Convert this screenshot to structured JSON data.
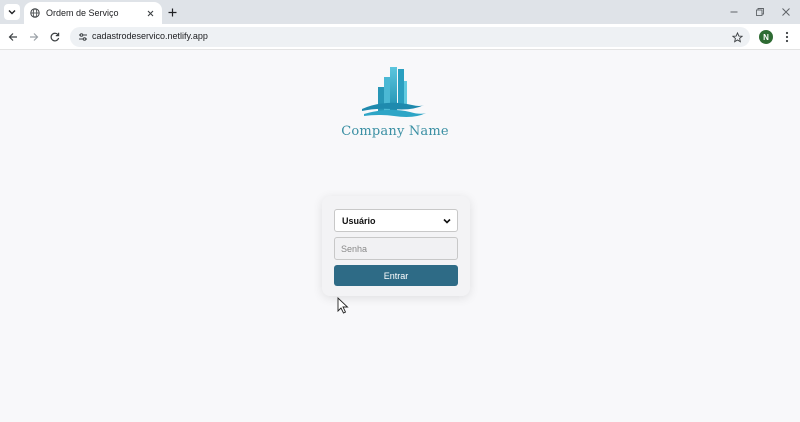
{
  "browser": {
    "tab": {
      "title": "Ordem de Serviço"
    },
    "address_bar": {
      "url": "cadastrodeservico.netlify.app"
    },
    "profile_initial": "N",
    "icons": [
      "tab-search-icon",
      "globe-icon",
      "close-icon",
      "plus-icon",
      "minimize-icon",
      "restore-icon",
      "back-icon",
      "forward-icon",
      "reload-icon",
      "site-settings-icon",
      "star-icon",
      "kebab-menu-icon"
    ]
  },
  "page": {
    "company_name": "Company Name",
    "login": {
      "user_select": {
        "selected": "Usuário",
        "options": [
          "Usuário"
        ]
      },
      "password": {
        "placeholder": "Senha",
        "value": ""
      },
      "submit_label": "Entrar"
    }
  },
  "colors": {
    "brand": "#3a8fa3",
    "button": "#2e6b86",
    "profile": "#2e6b33"
  }
}
